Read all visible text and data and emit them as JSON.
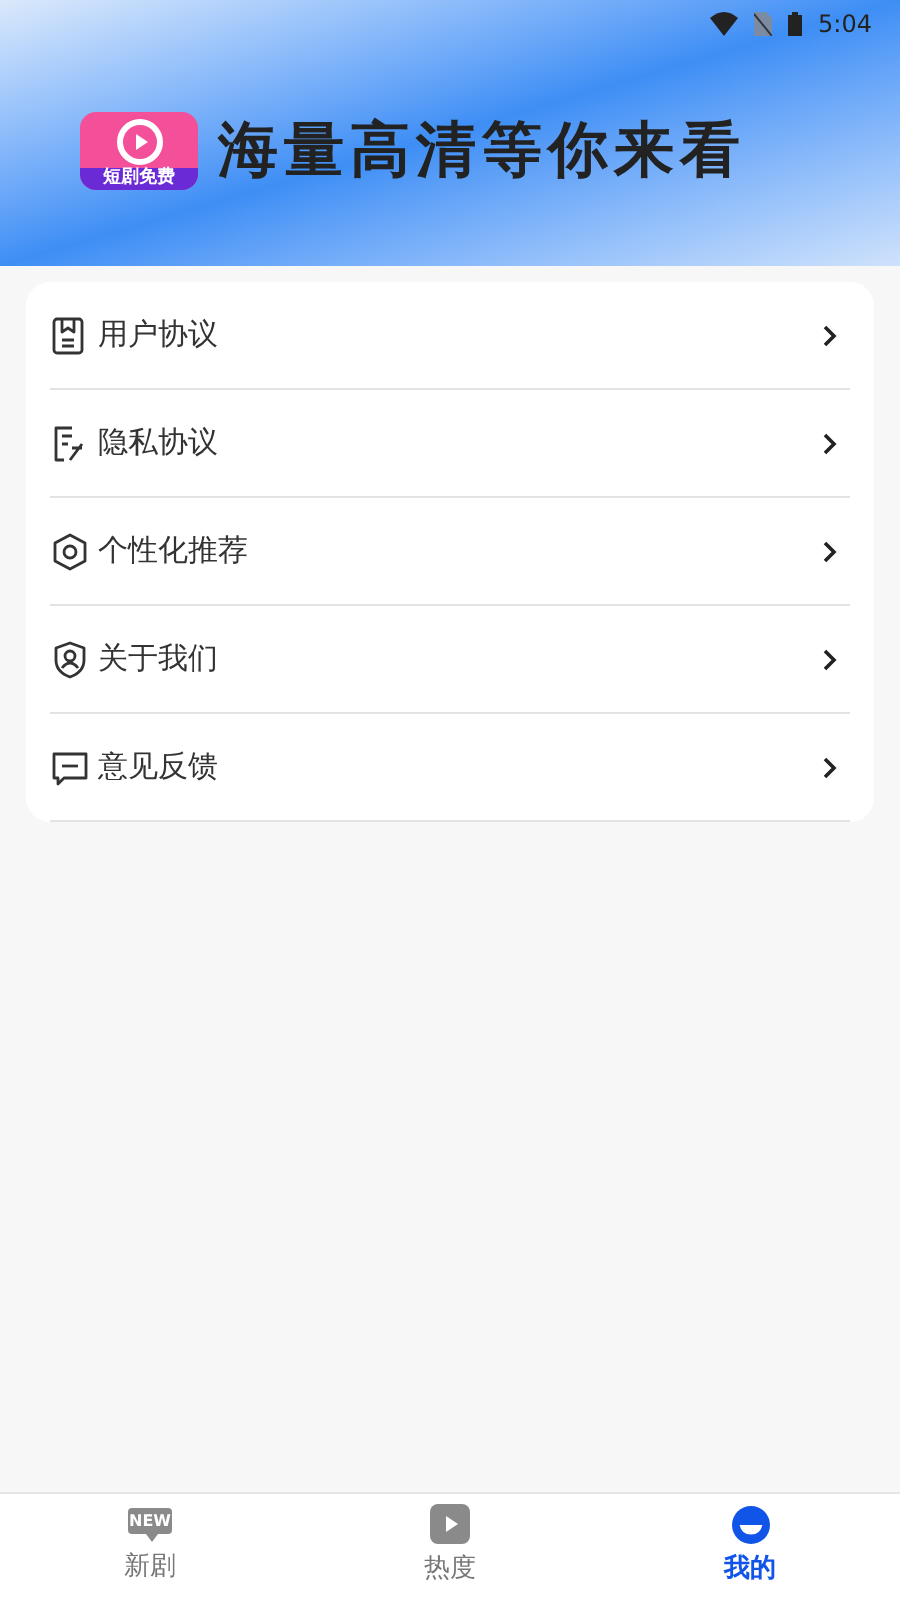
{
  "status_bar": {
    "time": "5:04"
  },
  "banner": {
    "logo_caption": "短剧免费",
    "slogan": "海量高清等你来看"
  },
  "menu": [
    {
      "kind": "agreement",
      "label": "用户协议"
    },
    {
      "kind": "privacy",
      "label": "隐私协议"
    },
    {
      "kind": "settings",
      "label": "个性化推荐"
    },
    {
      "kind": "about",
      "label": "关于我们"
    },
    {
      "kind": "feedback",
      "label": "意见反馈"
    }
  ],
  "tab_bar": [
    {
      "kind": "new",
      "label": "新剧",
      "icon_text": "NEW",
      "selected": false
    },
    {
      "kind": "play",
      "label": "热度",
      "selected": false
    },
    {
      "kind": "mine",
      "label": "我的",
      "selected": true
    }
  ]
}
